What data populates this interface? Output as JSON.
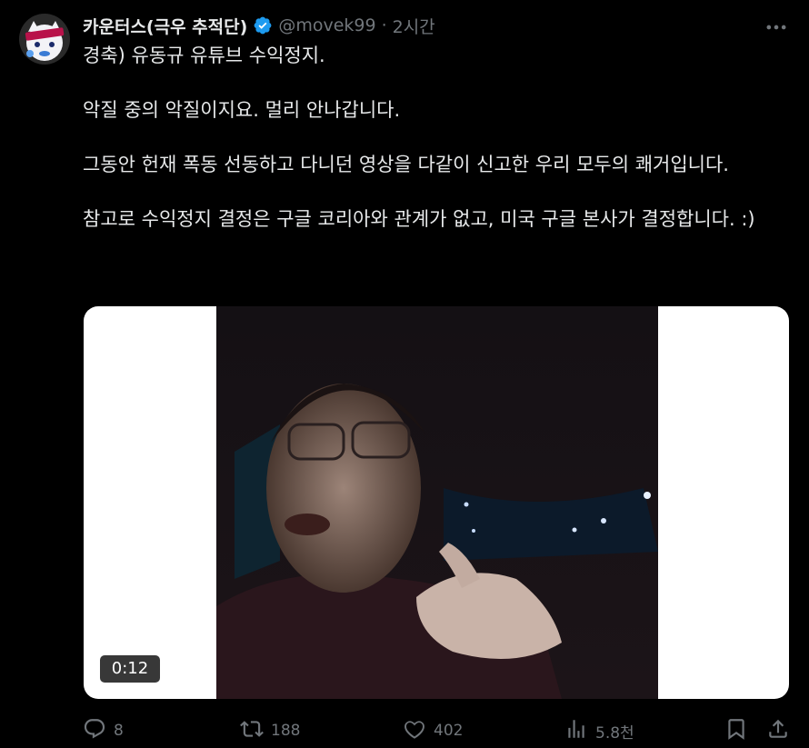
{
  "author": {
    "display_name": "카운터스(극우 추적단)",
    "handle": "@movek99",
    "separator": "·",
    "time": "2시간",
    "verified": true
  },
  "tweet": {
    "paragraphs": [
      "경축) 유동규 유튜브 수익정지.",
      "악질 중의 악질이지요. 멀리 안나갑니다.",
      "그동안 헌재 폭동 선동하고 다니던 영상을 다같이 신고한 우리 모두의 쾌거입니다.",
      "참고로 수익정지 결정은 구글 코리아와 관계가 없고, 미국 구글 본사가 결정합니다. :)"
    ]
  },
  "media": {
    "duration": "0:12"
  },
  "actions": {
    "reply_count": "8",
    "retweet_count": "188",
    "like_count": "402",
    "view_count": "5.8천"
  },
  "icons": {
    "more": "more-icon",
    "verified": "verified-badge-icon",
    "reply": "reply-icon",
    "retweet": "retweet-icon",
    "like": "like-icon",
    "views": "views-icon",
    "bookmark": "bookmark-icon",
    "share": "share-icon"
  },
  "colors": {
    "background": "#000000",
    "text": "#e7e9ea",
    "muted": "#71767b",
    "verified": "#1d9bf0"
  }
}
